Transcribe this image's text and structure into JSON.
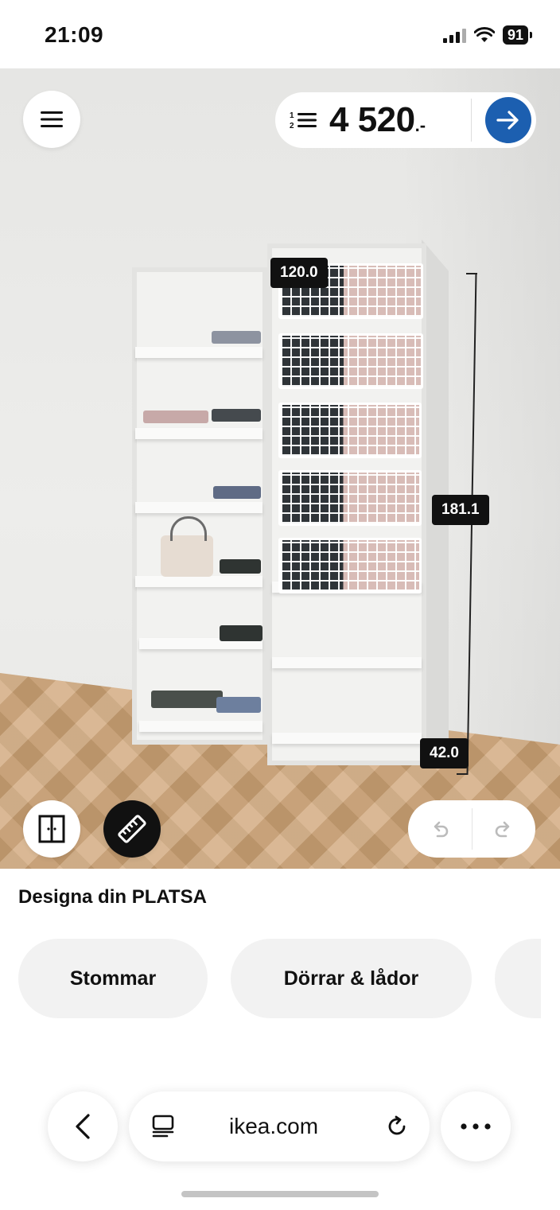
{
  "status_bar": {
    "time": "21:09",
    "battery": "91"
  },
  "scene": {
    "price": {
      "amount": "4 520",
      "suffix": ".-"
    },
    "dimensions": {
      "width": "120.0",
      "height": "181.1",
      "depth": "42.0"
    },
    "icons": {
      "menu": "hamburger-menu-icon",
      "list": "numbered-list-icon",
      "go": "arrow-right-icon",
      "doors": "double-door-icon",
      "measure": "ruler-icon",
      "undo": "undo-icon",
      "redo": "redo-icon"
    },
    "colors": {
      "accent_blue": "#1c5fb0",
      "dark": "#111111"
    }
  },
  "panel": {
    "title": "Designa din PLATSA",
    "chips": [
      "Stommar",
      "Dörrar & lådor"
    ]
  },
  "browser": {
    "url": "ikea.com",
    "icons": [
      "chevron-left-icon",
      "page-icon",
      "reload-icon",
      "more-icon"
    ]
  }
}
